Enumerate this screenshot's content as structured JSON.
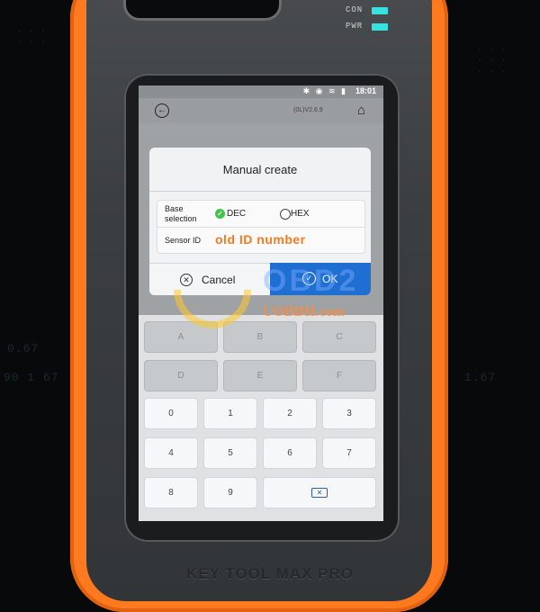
{
  "device": {
    "led_con_label": "CON",
    "led_pwr_label": "PWR",
    "brand": "KEY TOOL MAX PRO",
    "body_color": "#ff7a1f",
    "led_color": "#39e0e0"
  },
  "status_bar": {
    "icons": "✱ ◉ ≋ ▮",
    "time": "18:01"
  },
  "app_bar": {
    "version": "(0L)V2.6.9"
  },
  "dialog": {
    "title": "Manual create",
    "base_label": "Base selection",
    "dec_label": "DEC",
    "hex_label": "HEX",
    "sensor_label": "Sensor ID",
    "overlay_note": "old ID number",
    "cancel_label": "Cancel",
    "ok_label": "OK",
    "ok_color": "#1f6fd3"
  },
  "keypad": {
    "letters": [
      "A",
      "B",
      "C",
      "D",
      "E",
      "F"
    ],
    "digits": [
      "0",
      "1",
      "2",
      "3",
      "4",
      "5",
      "6",
      "7",
      "8",
      "9"
    ]
  },
  "watermark": {
    "logo": "OBD2",
    "url": "UOBDII.com"
  }
}
